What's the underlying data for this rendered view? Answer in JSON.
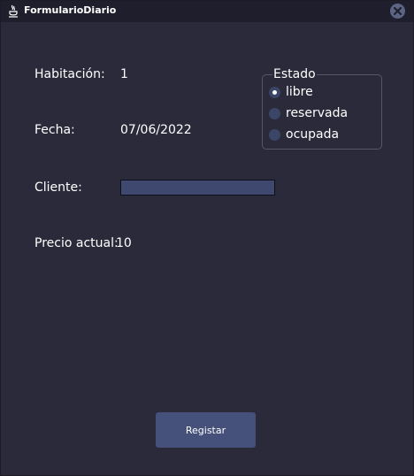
{
  "window": {
    "title": "FormularioDiario",
    "icon": "java-cup-icon",
    "close_icon": "close-icon"
  },
  "form": {
    "habitacion_label": "Habitación:",
    "habitacion_value": "1",
    "fecha_label": "Fecha:",
    "fecha_value": "07/06/2022",
    "cliente_label": "Cliente:",
    "cliente_value": "",
    "precio_label": "Precio actual:",
    "precio_value": "10"
  },
  "estado": {
    "title": "Estado",
    "options": [
      {
        "label": "libre",
        "selected": true
      },
      {
        "label": "reservada",
        "selected": false
      },
      {
        "label": "ocupada",
        "selected": false
      }
    ]
  },
  "actions": {
    "register_label": "Registar"
  },
  "colors": {
    "background": "#2b2a3a",
    "titlebar": "#1f1e2c",
    "accent": "#45517a",
    "text": "#ffffff"
  }
}
